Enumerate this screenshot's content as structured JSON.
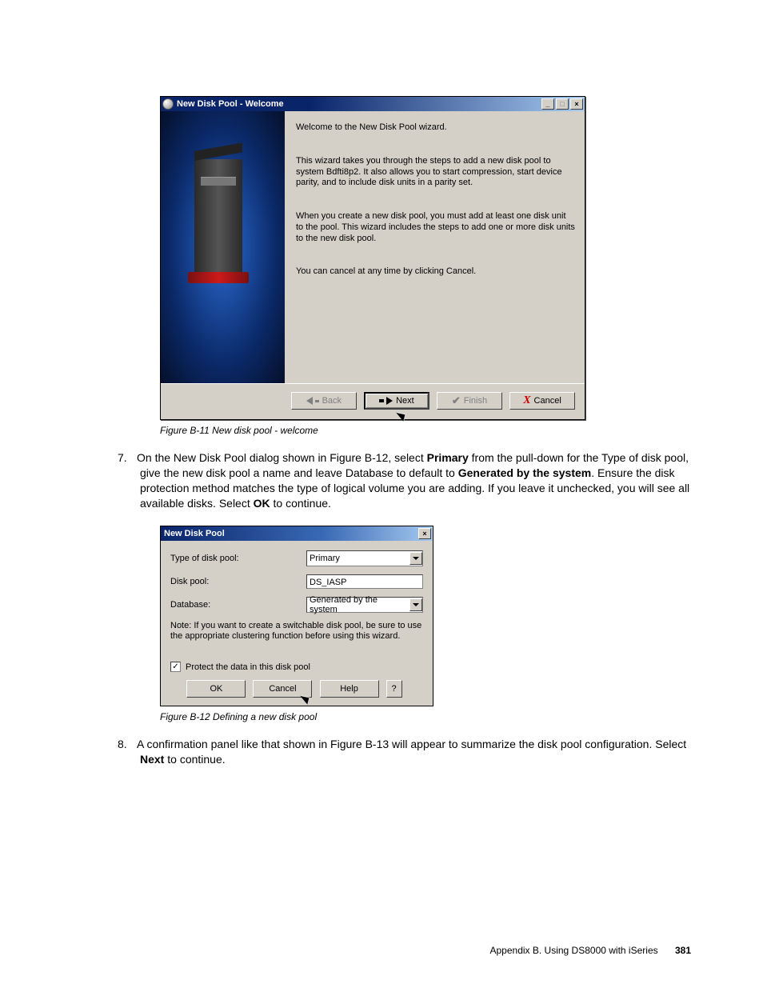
{
  "figure1": {
    "title": "New Disk Pool - Welcome",
    "p1": "Welcome to the New Disk Pool wizard.",
    "p2": "This wizard takes you through the steps to add a new disk pool to system Bdfti8p2. It also allows you to start compression, start device parity, and to include disk units in a parity set.",
    "p3": "When you create a new disk pool, you must add at least one disk unit to the pool. This wizard includes the steps to add one or more disk units to the new disk pool.",
    "p4": "You can cancel at any time by clicking Cancel.",
    "back": "Back",
    "next": "Next",
    "finish": "Finish",
    "cancel": "Cancel",
    "caption": "Figure B-11   New disk pool - welcome"
  },
  "step7": {
    "num": "7.",
    "t1": "On the New Disk Pool dialog shown in Figure B-12, select ",
    "b1": "Primary",
    "t2": " from the pull-down for the Type of disk pool, give the new disk pool a name and leave Database to default to ",
    "b2": "Generated by the system",
    "t3": ". Ensure the disk protection method matches the type of logical volume you are adding. If you leave it unchecked, you will see all available disks. Select ",
    "b3": "OK",
    "t4": " to continue."
  },
  "figure2": {
    "title": "New Disk Pool",
    "row1_label": "Type of disk pool:",
    "row1_value": "Primary",
    "row2_label": "Disk pool:",
    "row2_value": "DS_IASP",
    "row3_label": "Database:",
    "row3_value": "Generated by the system",
    "note": "Note:  If you want to create a switchable disk pool, be sure to use the appropriate clustering function before using this wizard.",
    "cb_label": "Protect the data in this disk pool",
    "ok": "OK",
    "cancel": "Cancel",
    "help": "Help",
    "q": "?",
    "caption": "Figure B-12   Defining a new disk pool"
  },
  "step8": {
    "num": "8.",
    "t1": "A confirmation panel like that shown in Figure B-13 will appear to summarize the disk pool configuration. Select ",
    "b1": "Next",
    "t2": " to continue."
  },
  "footer": {
    "text": "Appendix B. Using DS8000 with iSeries",
    "page": "381"
  }
}
